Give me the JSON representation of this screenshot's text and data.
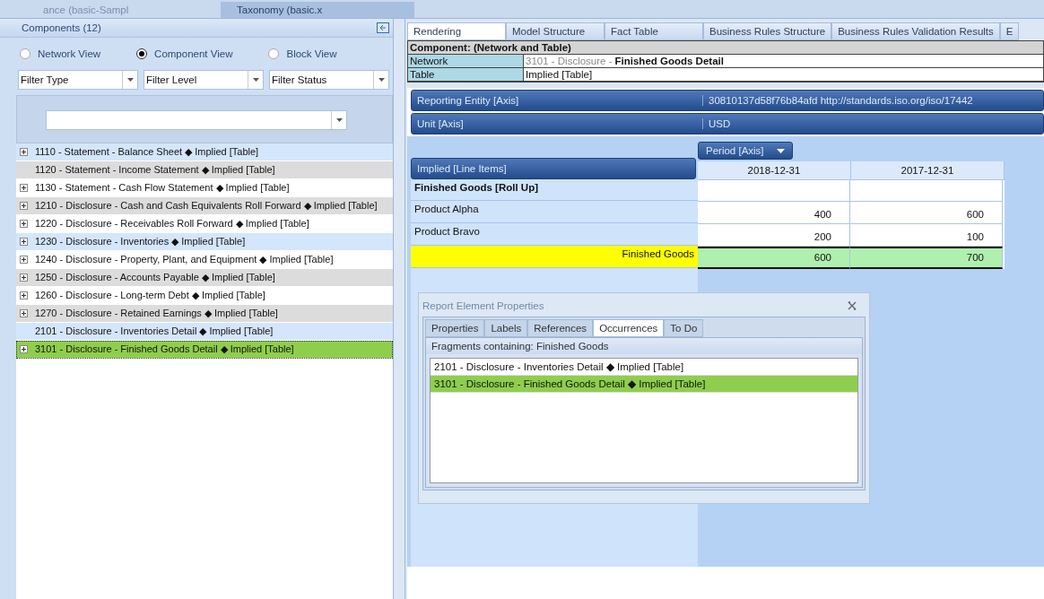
{
  "doc_tabs": [
    {
      "label": "ance (basic-Sampl",
      "selected": false
    },
    {
      "label": "Taxonomy (basic.x",
      "selected": true
    }
  ],
  "components": {
    "title": "Components (12)",
    "views": [
      {
        "label": "Network View",
        "selected": false
      },
      {
        "label": "Component View",
        "selected": true
      },
      {
        "label": "Block View",
        "selected": false
      }
    ],
    "filters": [
      "Filter Type",
      "Filter Level",
      "Filter Status"
    ],
    "items": [
      {
        "label": "1110 - Statement - Balance Sheet ◆ Implied [Table]",
        "expandable": true,
        "color": "#d4e6fb",
        "selected": false
      },
      {
        "label": "1120 - Statement - Income Statement ◆ Implied [Table]",
        "expandable": false,
        "color": "#dcdcdc",
        "selected": false
      },
      {
        "label": "1130 - Statement - Cash Flow Statement ◆ Implied [Table]",
        "expandable": true,
        "color": "#ffffff",
        "selected": false
      },
      {
        "label": "1210 - Disclosure - Cash and Cash Equivalents Roll Forward ◆ Implied [Table]",
        "expandable": true,
        "color": "#dcdcdc",
        "selected": false
      },
      {
        "label": "1220 - Disclosure - Receivables Roll Forward ◆ Implied [Table]",
        "expandable": true,
        "color": "#ffffff",
        "selected": false
      },
      {
        "label": "1230 - Disclosure - Inventories ◆ Implied [Table]",
        "expandable": true,
        "color": "#d4e6fb",
        "selected": false
      },
      {
        "label": "1240 - Disclosure - Property, Plant, and Equipment ◆ Implied [Table]",
        "expandable": true,
        "color": "#ffffff",
        "selected": false
      },
      {
        "label": "1250 - Disclosure - Accounts Payable ◆ Implied [Table]",
        "expandable": true,
        "color": "#dcdcdc",
        "selected": false
      },
      {
        "label": "1260 - Disclosure - Long-term Debt ◆ Implied [Table]",
        "expandable": true,
        "color": "#ffffff",
        "selected": false
      },
      {
        "label": "1270 - Disclosure - Retained Earnings ◆ Implied [Table]",
        "expandable": true,
        "color": "#dcdcdc",
        "selected": false
      },
      {
        "label": "2101 - Disclosure - Inventories Detail ◆ Implied [Table]",
        "expandable": false,
        "color": "#d4e6fb",
        "selected": false
      },
      {
        "label": "3101 - Disclosure - Finished Goods Detail ◆ Implied [Table]",
        "expandable": true,
        "color": "#8fce4d",
        "selected": true
      }
    ]
  },
  "view_tabs": [
    {
      "label": "Rendering",
      "selected": true
    },
    {
      "label": "Model Structure",
      "selected": false
    },
    {
      "label": "Fact Table",
      "selected": false
    },
    {
      "label": "Business Rules Structure",
      "selected": false
    },
    {
      "label": "Business Rules Validation Results",
      "selected": false
    },
    {
      "label": "E",
      "selected": false
    }
  ],
  "component": {
    "heading": "Component: (Network and Table)",
    "network_label": "Network",
    "network_prefix": "3101 - Disclosure -",
    "network_name": "Finished Goods Detail",
    "table_label": "Table",
    "table_value": "Implied [Table]"
  },
  "axes": [
    {
      "name": "Reporting Entity [Axis]",
      "value": "30810137d58f76b84afd http://standards.iso.org/iso/17442"
    },
    {
      "name": "Unit [Axis]",
      "value": "USD"
    }
  ],
  "period_axis": "Period [Axis]",
  "line_items": "Implied [Line Items]",
  "columns": [
    "2018-12-31",
    "2017-12-31"
  ],
  "rows": [
    {
      "label": "Finished Goods [Roll Up]",
      "kind": "header"
    },
    {
      "label": "Product Alpha",
      "kind": "item",
      "values": [
        "400",
        "600"
      ]
    },
    {
      "label": "Product Bravo",
      "kind": "item",
      "values": [
        "200",
        "100"
      ]
    },
    {
      "label": "Finished Goods",
      "kind": "total",
      "values": [
        "600",
        "700"
      ]
    }
  ],
  "dialog": {
    "title": "Report Element Properties",
    "tabs": [
      {
        "label": "Properties",
        "selected": false
      },
      {
        "label": "Labels",
        "selected": false
      },
      {
        "label": "References",
        "selected": false
      },
      {
        "label": "Occurrences",
        "selected": true
      },
      {
        "label": "To Do",
        "selected": false
      }
    ],
    "caption": "Fragments containing: Finished Goods",
    "items": [
      {
        "label": "2101 - Disclosure - Inventories Detail ◆ Implied [Table]",
        "selected": false
      },
      {
        "label": "3101 - Disclosure - Finished Goods Detail ◆ Implied [Table]",
        "selected": true
      }
    ]
  }
}
